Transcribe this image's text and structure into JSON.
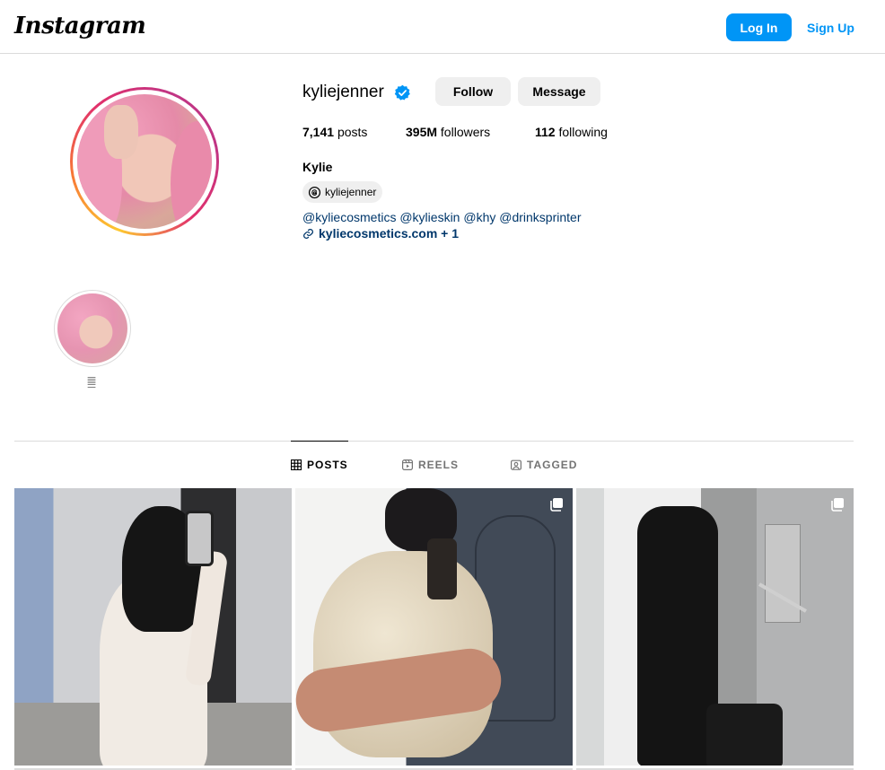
{
  "header": {
    "logo_text": "Instagram",
    "login_label": "Log In",
    "signup_label": "Sign Up",
    "accent_color": "#0095f6"
  },
  "profile": {
    "username": "kyliejenner",
    "verified": true,
    "follow_label": "Follow",
    "message_label": "Message",
    "stats": {
      "posts_count": "7,141",
      "posts_label": "posts",
      "followers_count": "395M",
      "followers_label": "followers",
      "following_count": "112",
      "following_label": "following"
    },
    "full_name": "Kylie",
    "threads_handle": "kyliejenner",
    "bio_mentions": [
      "@kyliecosmetics",
      "@kylieskin",
      "@khy",
      "@drinksprinter"
    ],
    "bio_link": "kyliecosmetics.com + 1"
  },
  "highlights": [
    {
      "label": "𝄛"
    }
  ],
  "tabs": [
    {
      "label": "POSTS",
      "icon": "grid-icon",
      "active": true
    },
    {
      "label": "REELS",
      "icon": "reels-icon",
      "active": false
    },
    {
      "label": "TAGGED",
      "icon": "tagged-icon",
      "active": false
    }
  ],
  "posts": [
    {
      "description_icon": "none"
    },
    {
      "description_icon": "carousel-icon"
    },
    {
      "description_icon": "carousel-icon"
    }
  ]
}
